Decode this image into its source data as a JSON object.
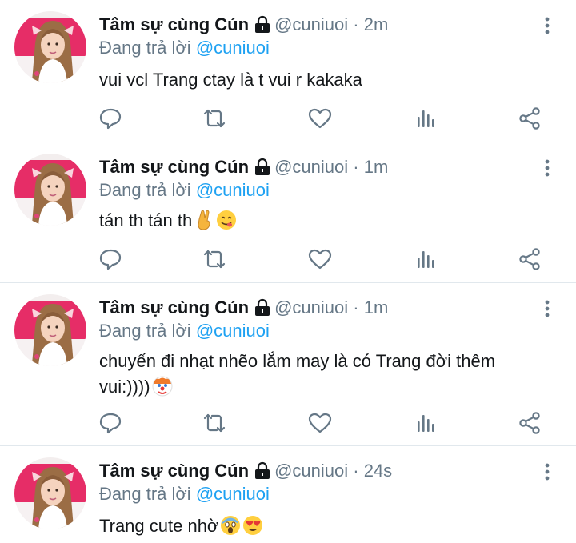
{
  "colors": {
    "text": "#14171a",
    "secondary": "#657786",
    "link": "#1da1f2",
    "divider": "#e1e8ed",
    "icon": "#657786"
  },
  "icons": {
    "lock": "lock-icon",
    "more": "more-vertical-icon",
    "reply": "reply-icon",
    "retweet": "retweet-icon",
    "like": "heart-icon",
    "analytics": "analytics-icon",
    "share": "share-icon"
  },
  "tweets": [
    {
      "display_name": "Tâm sự cùng Cún",
      "handle": "@cuniuoi",
      "separator": "·",
      "time": "2m",
      "reply_prefix": "Đang trả lời",
      "reply_mention": "@cuniuoi",
      "text": "vui vcl Trang ctay là t vui r kakaka",
      "emojis": []
    },
    {
      "display_name": "Tâm sự cùng Cún",
      "handle": "@cuniuoi",
      "separator": "·",
      "time": "1m",
      "reply_prefix": "Đang trả lời",
      "reply_mention": "@cuniuoi",
      "text": "tán th tán th",
      "emojis": [
        "crossed-fingers",
        "yum-face"
      ]
    },
    {
      "display_name": "Tâm sự cùng Cún",
      "handle": "@cuniuoi",
      "separator": "·",
      "time": "1m",
      "reply_prefix": "Đang trả lời",
      "reply_mention": "@cuniuoi",
      "text": "chuyến đi nhạt nhẽo lắm may là có Trang đời thêm vui:))))",
      "emojis": [
        "clown-face"
      ]
    },
    {
      "display_name": "Tâm sự cùng Cún",
      "handle": "@cuniuoi",
      "separator": "·",
      "time": "24s",
      "reply_prefix": "Đang trả lời",
      "reply_mention": "@cuniuoi",
      "text": "Trang cute nhờ",
      "emojis": [
        "screaming-face",
        "heart-eyes-face"
      ]
    }
  ]
}
